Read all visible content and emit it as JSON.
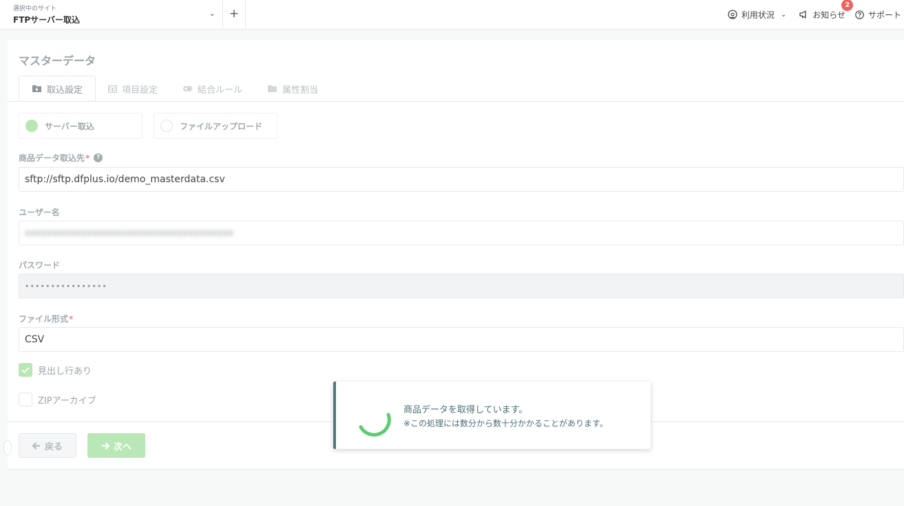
{
  "header": {
    "site_caption": "選択中のサイト",
    "site_name": "FTPサーバー取込",
    "add_symbol": "+",
    "usage_label": "利用状況",
    "notice_label": "お知らせ",
    "notice_count": "2",
    "support_label": "サポート"
  },
  "page": {
    "title": "マスターデータ",
    "tabs": [
      {
        "label": "取込設定",
        "icon": "import-icon",
        "active": true
      },
      {
        "label": "項目設定",
        "icon": "table-icon",
        "active": false
      },
      {
        "label": "結合ルール",
        "icon": "link-icon",
        "active": false
      },
      {
        "label": "属性割当",
        "icon": "folder-icon",
        "active": false
      }
    ]
  },
  "form": {
    "source_options": [
      {
        "label": "サーバー取込",
        "checked": true
      },
      {
        "label": "ファイルアップロード",
        "checked": false
      }
    ],
    "source_label": "商品データ取込先",
    "source_required": "*",
    "source_value": "sftp://sftp.dfplus.io/demo_masterdata.csv",
    "username_label": "ユーザー名",
    "password_label": "パスワード",
    "password_value": "••••••••••••••••",
    "format_label": "ファイル形式",
    "format_required": "*",
    "format_value": "CSV",
    "header_row_label": "見出し行あり",
    "header_row_checked": true,
    "zip_label": "ZIPアーカイブ",
    "zip_checked": false
  },
  "buttons": {
    "back_label": "戻る",
    "next_label": "次へ"
  },
  "toast": {
    "message": "商品データを取得しています。",
    "note": "※この処理には数分から数十分かかることがあります。"
  },
  "colors": {
    "accent_green": "#b8e6b4",
    "spinner_green": "#5ccc72",
    "toast_border": "#4c7b82",
    "badge_red": "#f0625e"
  }
}
